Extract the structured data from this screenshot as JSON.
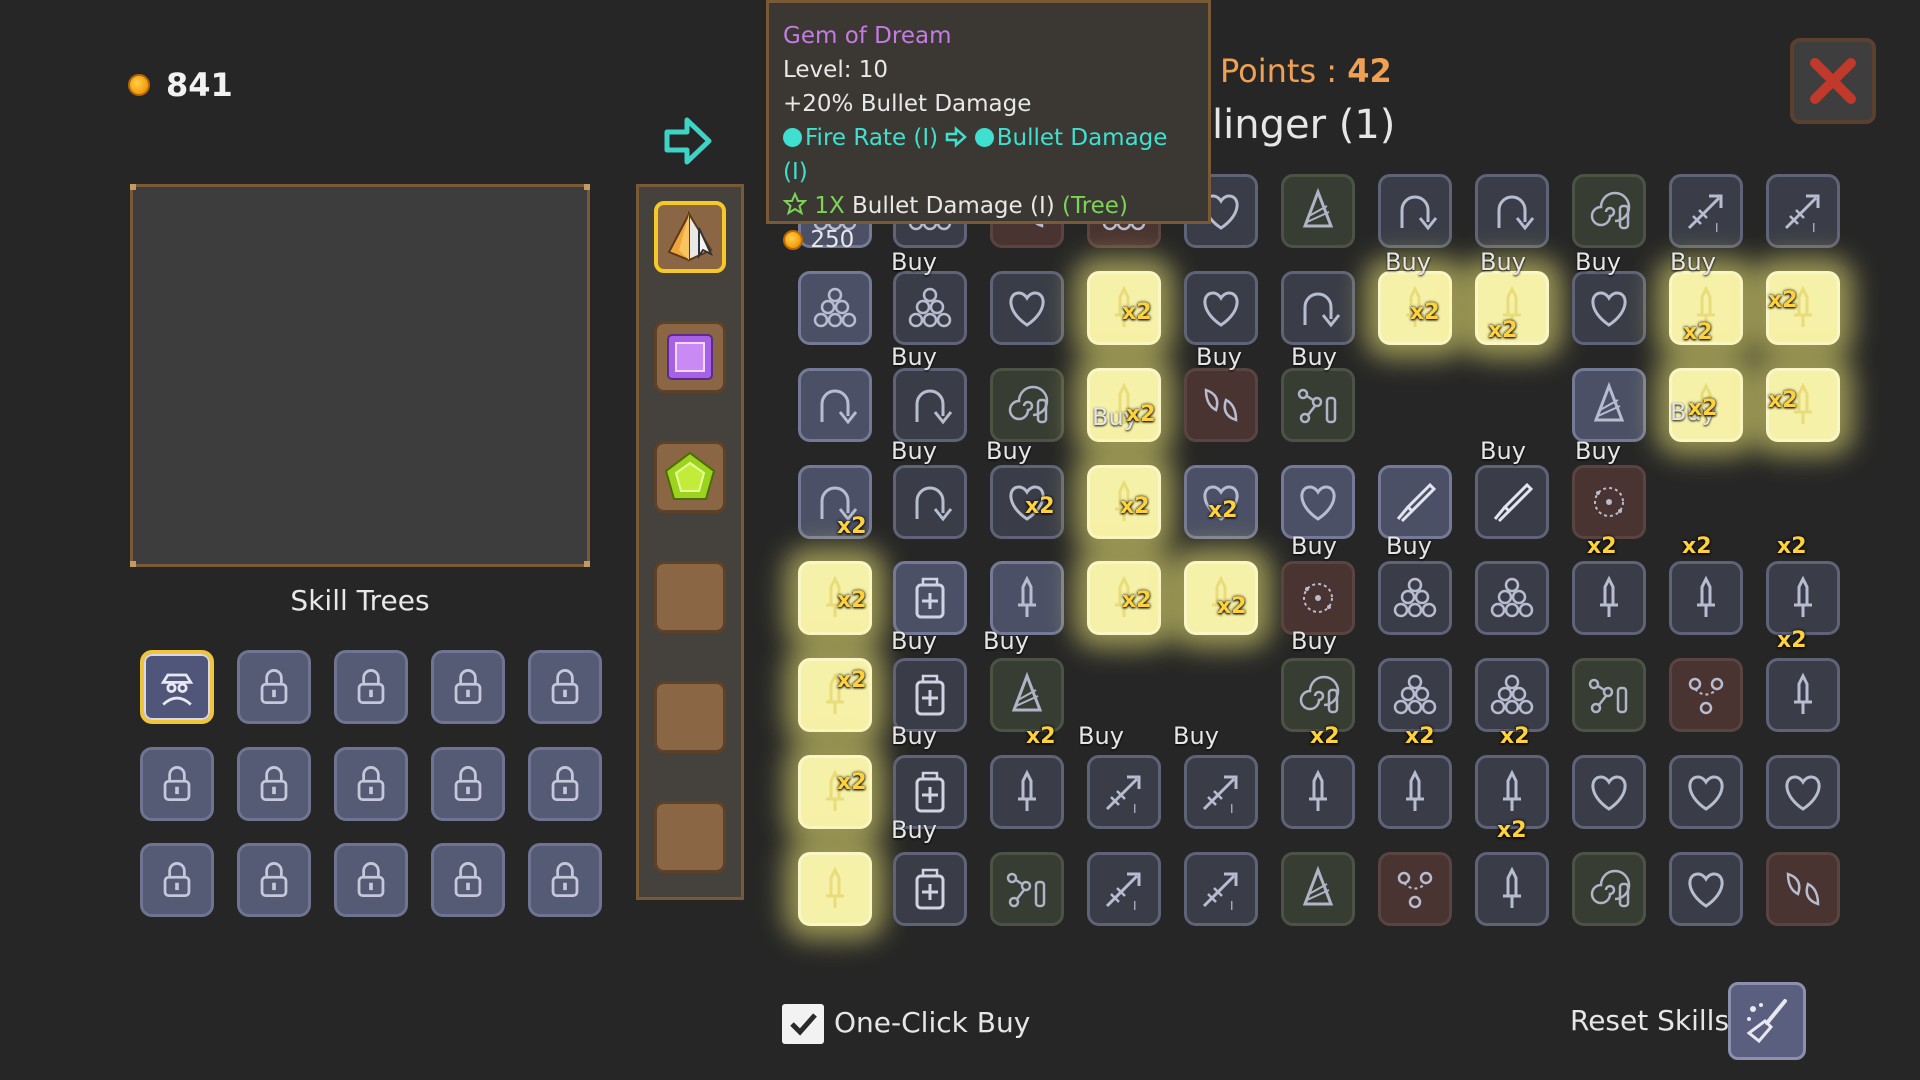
{
  "coins": {
    "amount": "841",
    "icon": "coin-icon"
  },
  "panel": {
    "skill_trees_label": "Skill Trees"
  },
  "tooltip": {
    "name": "Gem of Dream",
    "level": "Level: 10",
    "effect_value": "+20%",
    "effect_text": "Bullet Damage",
    "from_skill": "Fire Rate (I)",
    "to_skill": "Bullet Damage (I)",
    "star_count": "1X",
    "star_text": "Bullet Damage (I)",
    "star_tag": "(Tree)",
    "cost": "250"
  },
  "header": {
    "points_label": "Points :",
    "points_value": "42",
    "tree_name": "linger (1)"
  },
  "labels": {
    "buy": "Buy",
    "x2": "x2"
  },
  "footer": {
    "one_click_buy": "One-Click Buy",
    "one_click_checked": true,
    "reset_skills": "Reset Skills"
  },
  "colors": {
    "accent_gold": "#f0c53a",
    "tooltip_name": "#c47ce2",
    "link_cyan": "#3fe0cf",
    "tree_green": "#7cd455",
    "points_orange": "#f0a053",
    "multiplier_yellow": "#ffd23c"
  },
  "gems": [
    "gem-of-dream-icon",
    "purple-gem-icon",
    "green-gem-icon",
    "empty",
    "empty",
    "empty"
  ]
}
